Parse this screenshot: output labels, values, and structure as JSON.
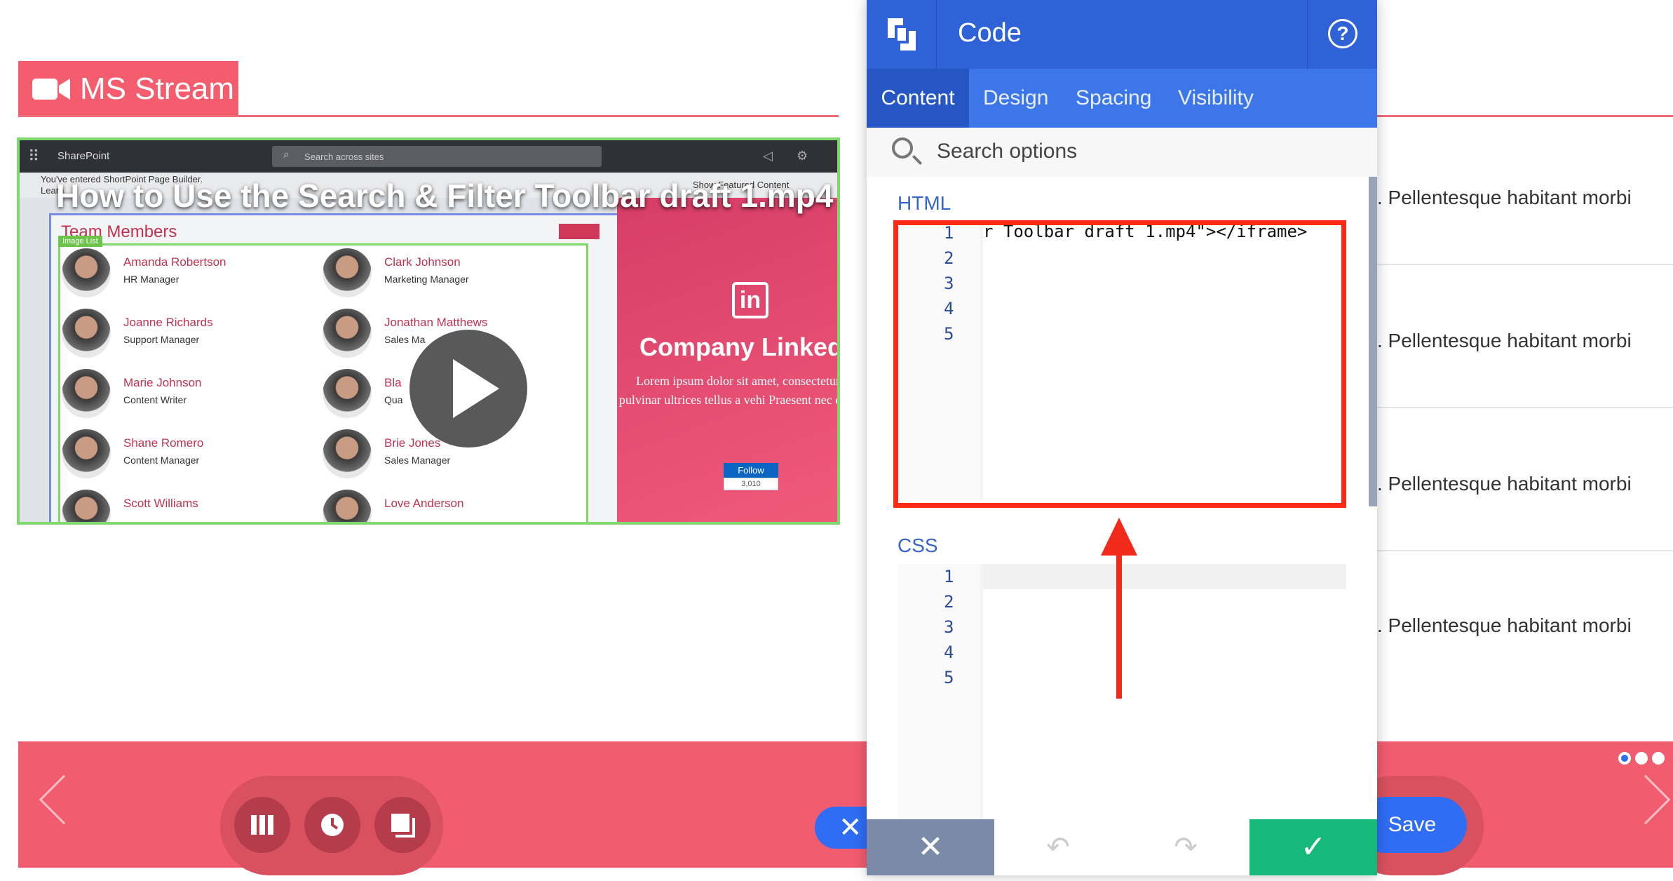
{
  "page": {
    "section_title": "MS Stream",
    "row_text": ". Pellentesque habitant morbi"
  },
  "video": {
    "sharepoint_brand": "SharePoint",
    "search_placeholder": "Search across sites",
    "notice_line1": "You've entered ShortPoint Page Builder.",
    "notice_line2": "Learn",
    "show_featured": "Show Featured Content",
    "title": "How to Use the Search & Filter Toolbar draft 1.mp4",
    "team_title": "Team Members",
    "image_list_tag": "Image List",
    "members": [
      {
        "name": "Amanda Robertson",
        "role": "HR Manager"
      },
      {
        "name": "Clark Johnson",
        "role": "Marketing Manager"
      },
      {
        "name": "Joanne Richards",
        "role": "Support Manager"
      },
      {
        "name": "Jonathan Matthews",
        "role": "Sales Ma"
      },
      {
        "name": "Marie Johnson",
        "role": "Content Writer"
      },
      {
        "name": "Bla",
        "role": "Qua"
      },
      {
        "name": "Shane Romero",
        "role": "Content Manager"
      },
      {
        "name": "Brie Jones",
        "role": "Sales Manager"
      },
      {
        "name": "Scott Williams",
        "role": ""
      },
      {
        "name": "Love Anderson",
        "role": ""
      }
    ],
    "linkedin_icon": "in",
    "company_title": "Company Linked",
    "lorem": "Lorem ipsum dolor sit amet, consectetur. Sed pulvinar ultrices tellus a vehi Praesent nec eros erat.",
    "follow_label": "Follow",
    "follow_count": "3,010"
  },
  "toolbar": {
    "save_label": "Save",
    "close_glyph": "✕",
    "dots": 3
  },
  "panel": {
    "title": "Code",
    "help_glyph": "?",
    "tabs": [
      "Content",
      "Design",
      "Spacing",
      "Visibility"
    ],
    "active_tab": "Content",
    "search_placeholder": "Search options",
    "html_label": "HTML",
    "css_label": "CSS",
    "html_line1": "r Toolbar draft 1.mp4\"></iframe>",
    "line_numbers": [
      "1",
      "2",
      "3",
      "4",
      "5"
    ],
    "cancel_glyph": "✕",
    "undo_glyph": "↶",
    "redo_glyph": "↷",
    "ok_glyph": "✓"
  },
  "colors": {
    "accent_pink": "#f45d6e",
    "panel_blue": "#2e62d6",
    "tab_blue": "#3c76e8",
    "ok_green": "#16b97a",
    "annotation_red": "#ff2a14"
  }
}
